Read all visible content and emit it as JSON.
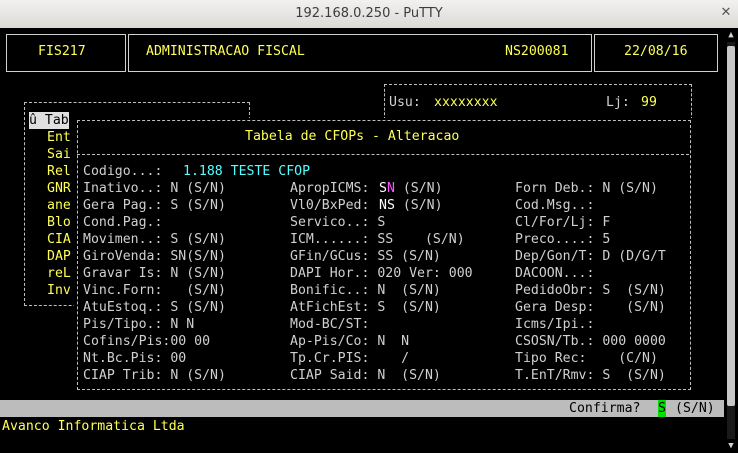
{
  "window": {
    "title": "192.168.0.250 - PuTTY"
  },
  "header": {
    "program": "FIS217",
    "module": "ADMINISTRACAO FISCAL",
    "terminal": "NS200081",
    "date": "22/08/16"
  },
  "user": {
    "usu_label": "Usu:",
    "usu_value": "xxxxxxxx",
    "lj_label": "Lj:",
    "lj_value": "99"
  },
  "menu": {
    "items": [
      "û Tab",
      "Ent",
      "Sai",
      "Rel",
      "GNR",
      "ane",
      "Blo",
      "CIA",
      "DAP",
      "reL",
      "Inv"
    ]
  },
  "dialog": {
    "title": "Tabela de CFOPs - Alteracao",
    "codigo_label": "Codigo...:",
    "codigo_value": "1.188 TESTE CFOP",
    "rows": [
      {
        "c1": "Inativo..: N (S/N)",
        "c2": "ApropICMS:",
        "c2v": "S",
        "c2v2": "N",
        "c2r": " (S/N)",
        "c3": "Forn Deb.: N (S/N)"
      },
      {
        "c1": "Gera Pag.: S (S/N)",
        "c2": "Vl0/BxPed:",
        "c2v": "NS",
        "c2v2": "",
        "c2r": " (S/N)",
        "c3": "Cod.Msg..:"
      },
      {
        "c1": "Cond.Pag.:",
        "c2": "Servico..: S",
        "c2v": "",
        "c2v2": "",
        "c2r": "",
        "c3": "Cl/For/Lj: F"
      },
      {
        "c1": "Movimen..: S (S/N)",
        "c2": "ICM......: SS    (S/N)",
        "c2v": "",
        "c2v2": "",
        "c2r": "",
        "c3": "Preco....: 5"
      },
      {
        "c1": "GiroVenda: SN(S/N)",
        "c2": "GFin/GCus: SS (S/N)",
        "c2v": "",
        "c2v2": "",
        "c2r": "",
        "c3": "Dep/Gon/T: D (D/G/T"
      },
      {
        "c1": "Gravar Is: N (S/N)",
        "c2": "DAPI Hor.: 020 Ver: 000",
        "c2v": "",
        "c2v2": "",
        "c2r": "",
        "c3": "DACOON...:"
      },
      {
        "c1": "Vinc.Forn:   (S/N)",
        "c2": "Bonific..: N  (S/N)",
        "c2v": "",
        "c2v2": "",
        "c2r": "",
        "c3": "PedidoObr: S  (S/N)"
      },
      {
        "c1": "AtuEstoq.: S (S/N)",
        "c2": "AtFichEst: S  (S/N)",
        "c2v": "",
        "c2v2": "",
        "c2r": "",
        "c3": "Gera Desp:    (S/N)"
      },
      {
        "c1": "Pis/Tipo.: N N",
        "c2": "Mod-BC/ST:",
        "c2v": "",
        "c2v2": "",
        "c2r": "",
        "c3": "Icms/Ipi.:"
      },
      {
        "c1": "Cofins/Pis:00 00",
        "c2": "Ap-Pis/Co: N  N",
        "c2v": "",
        "c2v2": "",
        "c2r": "",
        "c3": "CSOSN/Tb.: 000 0000"
      },
      {
        "c1": "Nt.Bc.Pis: 00",
        "c2": "Tp.Cr.PIS:    /",
        "c2v": "",
        "c2v2": "",
        "c2r": "",
        "c3": "Tipo Rec:    (C/N)"
      },
      {
        "c1": "CIAP Trib: N (S/N)",
        "c2": "CIAP Said: N  (S/N)",
        "c2v": "",
        "c2v2": "",
        "c2r": "",
        "c3": "T.EnT/Rmv: S  (S/N)"
      }
    ]
  },
  "status": {
    "prompt": "Confirma?",
    "value": "S",
    "options": "(S/N)"
  },
  "footer": {
    "company": "Avanco Informatica Ltda"
  },
  "colors": {
    "label": "#d0d0d0",
    "header": "#ffff55",
    "codigo": "#55ffff",
    "highlight": "#00e000",
    "magenta": "#ff55ff"
  }
}
